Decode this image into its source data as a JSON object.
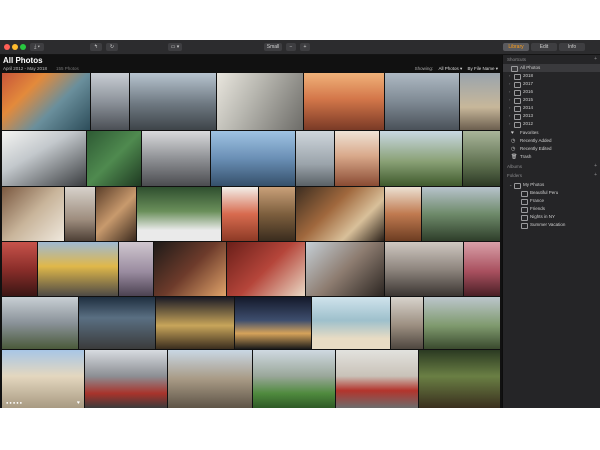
{
  "toolbar": {
    "import_label": "⤓ ▾",
    "back_label": "↰",
    "rotate_label": "↻",
    "layout_label": "▭ ▾",
    "size_label": "Small",
    "zoom_minus": "−",
    "zoom_plus": "+",
    "tabs": [
      {
        "label": "Library",
        "active": true
      },
      {
        "label": "Edit",
        "active": false
      },
      {
        "label": "Info",
        "active": false
      }
    ]
  },
  "main": {
    "title": "All Photos",
    "date_range": "April 2012 - May 2018",
    "photo_count": "155 Photos",
    "showing_label": "Showing:",
    "filter_value": "All Photos ▾",
    "sort_value": "By File Name ▾"
  },
  "sidebar": {
    "shortcuts_heading": "Shortcuts",
    "shortcuts": [
      {
        "label": "All Photos",
        "icon": "photos-icon",
        "selected": true
      },
      {
        "label": "2018",
        "icon": "folder-icon"
      },
      {
        "label": "2017",
        "icon": "folder-icon"
      },
      {
        "label": "2016",
        "icon": "folder-icon"
      },
      {
        "label": "2015",
        "icon": "folder-icon"
      },
      {
        "label": "2014",
        "icon": "folder-icon"
      },
      {
        "label": "2013",
        "icon": "folder-icon"
      },
      {
        "label": "2012",
        "icon": "folder-icon"
      },
      {
        "label": "Favorites",
        "icon": "heart-icon"
      },
      {
        "label": "Recently Added",
        "icon": "clock-icon"
      },
      {
        "label": "Recently Edited",
        "icon": "clock-icon"
      },
      {
        "label": "Trash",
        "icon": "trash-icon"
      }
    ],
    "albums_heading": "Albums",
    "folders_heading": "Folders",
    "folders": [
      {
        "label": "My Photos",
        "level": 0
      },
      {
        "label": "Beautiful Peru",
        "level": 1
      },
      {
        "label": "France",
        "level": 1
      },
      {
        "label": "Friends",
        "level": 1
      },
      {
        "label": "Nights in NY",
        "level": 1
      },
      {
        "label": "Summer Vacation",
        "level": 1
      }
    ]
  },
  "colors": {
    "accent": "#ff9f1a",
    "window_bg": "#1b1b1d",
    "sidebar_bg": "#252527"
  }
}
